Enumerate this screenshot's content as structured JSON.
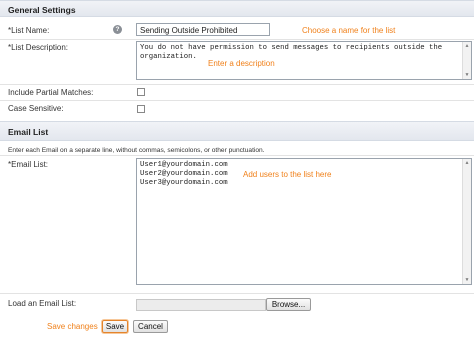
{
  "general": {
    "header": "General Settings",
    "list_name_label": "*List Name:",
    "help_icon": "?",
    "list_name_value": "Sending Outside Prohibited",
    "list_name_hint": "Choose a name for the list",
    "list_description_label": "*List Description:",
    "list_description_value": "You do not have permission to send messages to recipients outside the organization.",
    "list_description_hint": "Enter a description",
    "partial_label": "Include Partial Matches:",
    "partial_checked": false,
    "case_label": "Case Sensitive:",
    "case_checked": false
  },
  "email": {
    "header": "Email List",
    "description": "Enter each Email on a separate line, without commas, semicolons, or other punctuation.",
    "email_label": "*Email List:",
    "email_value": "User1@yourdomain.com\nUser2@yourdomain.com\nUser3@yourdomain.com",
    "email_hint": "Add users to the list here",
    "load_label": "Load an Email List:",
    "browse_label": "Browse..."
  },
  "actions": {
    "hint": "Save changes",
    "save_label": "Save",
    "cancel_label": "Cancel"
  },
  "colors": {
    "hint": "#f0801a",
    "header_bg": "#e3e7ee"
  }
}
